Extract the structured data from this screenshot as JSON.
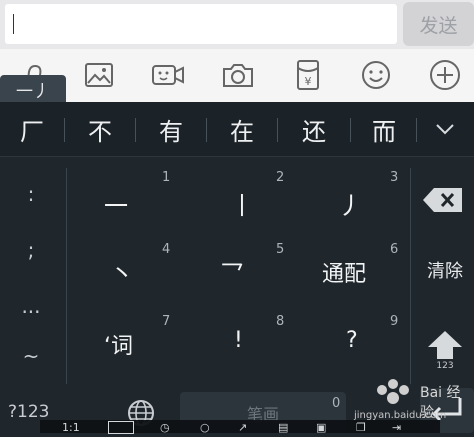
{
  "input_bar": {
    "send_label": "发送"
  },
  "ime_tab": {
    "label": "一丿"
  },
  "toolbar": {
    "icons": [
      "voice-icon",
      "image-icon",
      "video-icon",
      "camera-icon",
      "red-packet-icon",
      "emoji-icon",
      "add-icon"
    ],
    "red_packet_symbol": "¥"
  },
  "candidates": [
    "厂",
    "不",
    "有",
    "在",
    "还",
    "而"
  ],
  "left_symbols": [
    ":",
    ";",
    "...",
    "~"
  ],
  "keys": [
    {
      "num": "1",
      "glyph": "一"
    },
    {
      "num": "2",
      "glyph": "丨"
    },
    {
      "num": "3",
      "glyph": "丿"
    },
    {
      "num": "4",
      "glyph": "丶"
    },
    {
      "num": "5",
      "glyph": "乛"
    },
    {
      "num": "6",
      "glyph": "通配"
    },
    {
      "num": "7",
      "glyph": "‘词"
    },
    {
      "num": "8",
      "glyph": "!"
    },
    {
      "num": "9",
      "glyph": "?"
    }
  ],
  "right_keys": {
    "clear_label": "清除",
    "shift_sub": "123"
  },
  "bottom_row": {
    "sym_switch": "?123",
    "space_label": "笔画",
    "zero": "0"
  },
  "overlay_strip": [
    "1:1"
  ],
  "watermark": {
    "text": "Bai 经验",
    "url": "jingyan.baidu.com"
  },
  "colors": {
    "keyboard_bg": "#1f262c",
    "toolbar_bg": "#f5f5f5",
    "text_light": "#f2f4f5"
  }
}
